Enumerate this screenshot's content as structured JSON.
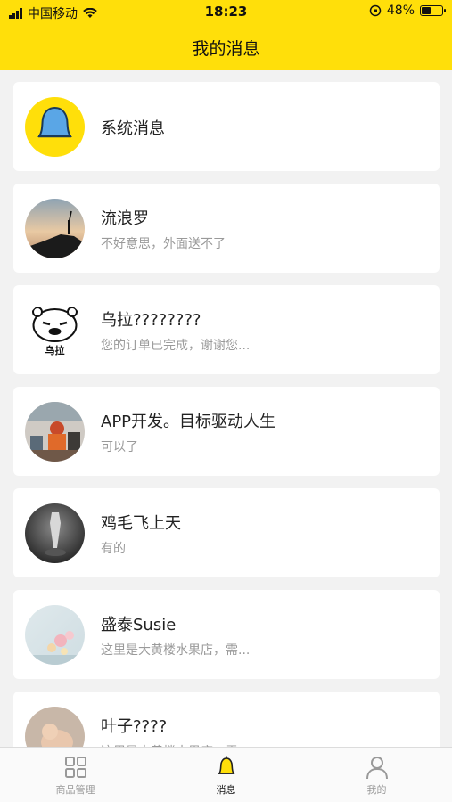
{
  "status_bar": {
    "carrier": "中国移动",
    "time": "18:23",
    "battery_percent": "48%",
    "battery_level": 0.48
  },
  "header": {
    "title": "我的消息",
    "background": "#ffdf0a"
  },
  "messages": [
    {
      "name": "系统消息",
      "preview": "",
      "avatar": "bell-icon"
    },
    {
      "name": "流浪罗",
      "preview": "不好意思，外面送不了",
      "avatar": "mountain-silhouette"
    },
    {
      "name": "乌拉????????",
      "preview": "您的订单已完成，谢谢您...",
      "avatar": "bear-meme",
      "avatar_text": "乌拉"
    },
    {
      "name": "APP开发。目标驱动人生",
      "preview": "可以了",
      "avatar": "photo"
    },
    {
      "name": "鸡毛飞上天",
      "preview": "有的",
      "avatar": "grayscale-photo"
    },
    {
      "name": "盛泰Susie",
      "preview": "这里是大黄楼水果店，需...",
      "avatar": "flower-photo"
    },
    {
      "name": "叶子????",
      "preview": "这里是大黄楼水果店，需...",
      "avatar": "baby-photo"
    }
  ],
  "tabbar": {
    "tabs": [
      {
        "label": "商品管理",
        "icon": "grid-icon",
        "active": false
      },
      {
        "label": "消息",
        "icon": "bell-icon",
        "active": true
      },
      {
        "label": "我的",
        "icon": "person-icon",
        "active": false
      }
    ]
  }
}
